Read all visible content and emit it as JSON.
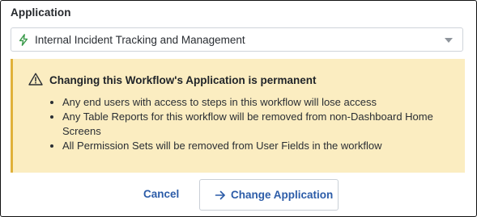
{
  "application_field": {
    "label": "Application",
    "selected_value": "Internal Incident Tracking and Management",
    "icon": "lightning-bolt-icon",
    "icon_color": "#3a9a4a"
  },
  "warning": {
    "icon": "warning-triangle-icon",
    "title": "Changing this Workflow's Application is permanent",
    "items": [
      "Any end users with access to steps in this workflow will lose access",
      "Any Table Reports for this workflow will be removed from non-Dashboard Home Screens",
      "All Permission Sets will be removed from User Fields in the workflow"
    ],
    "background_color": "#fbedc1",
    "accent_color": "#e0b13a"
  },
  "actions": {
    "cancel_label": "Cancel",
    "change_label": "Change Application",
    "change_icon": "arrow-right-icon",
    "link_color": "#2c5ca8"
  }
}
